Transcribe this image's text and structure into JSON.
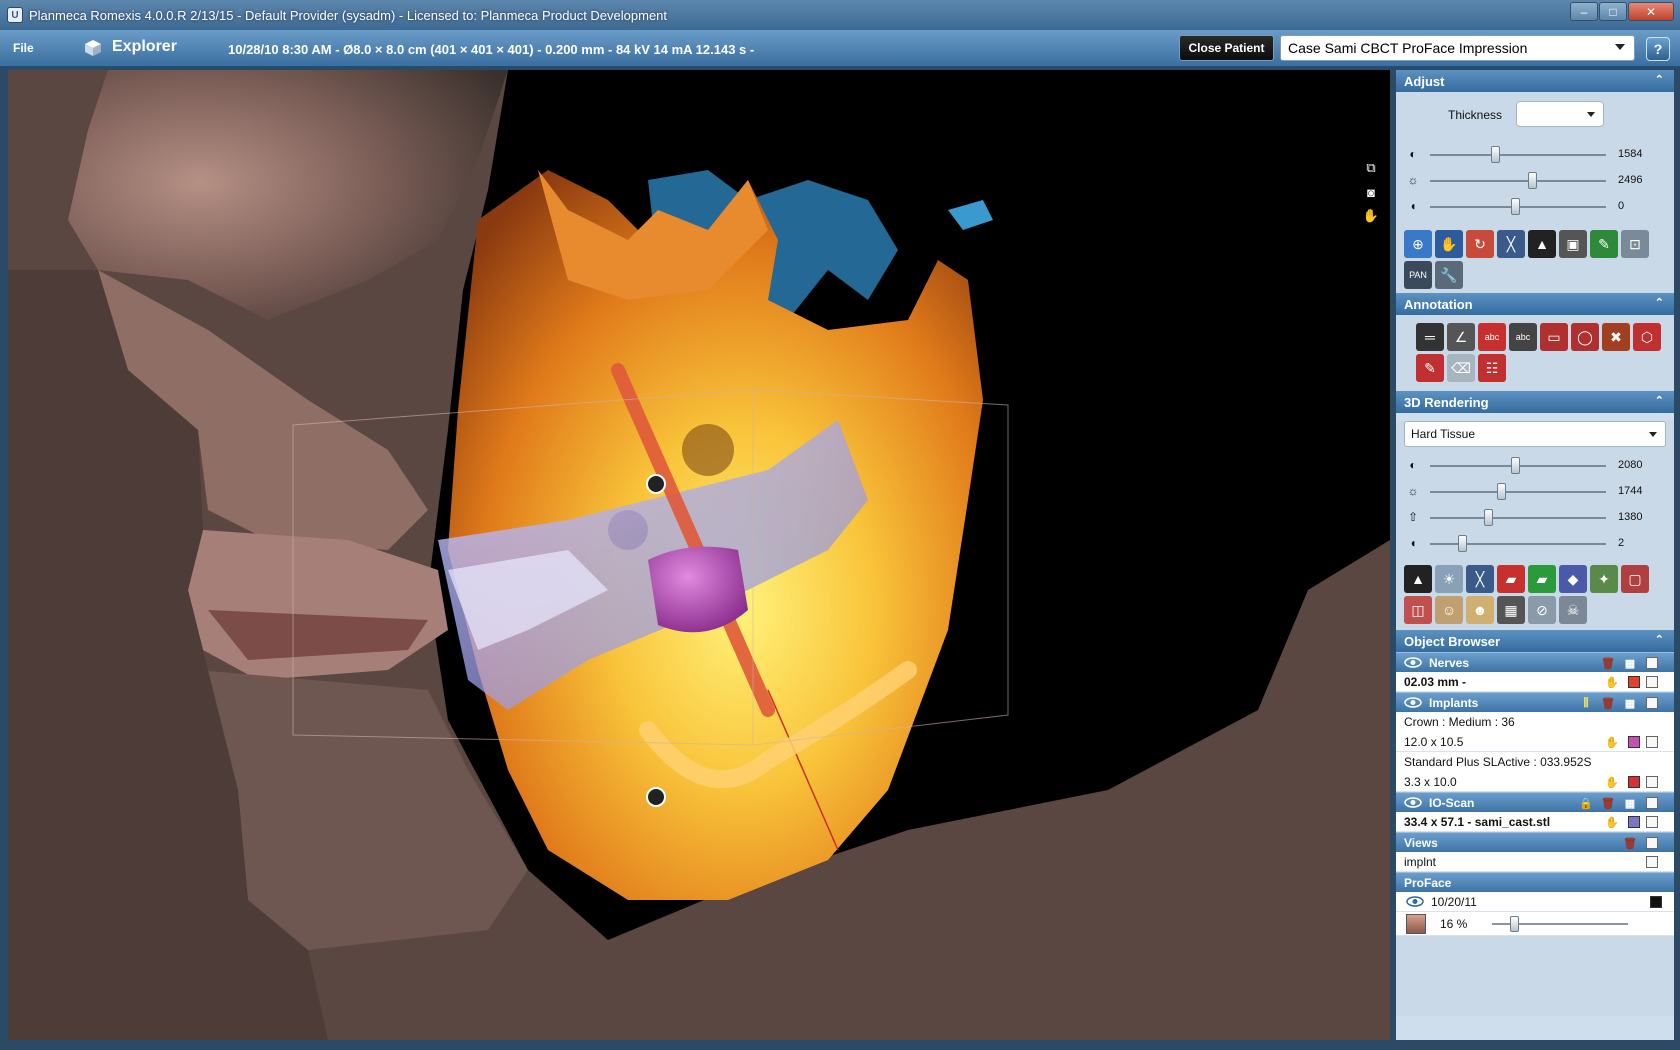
{
  "window": {
    "title": "Planmeca Romexis 4.0.0.R  2/13/15 - Default Provider (sysadm) - Licensed to: Planmeca Product Development",
    "minimize": "–",
    "maximize": "□",
    "close": "✕"
  },
  "header": {
    "file_menu": "File",
    "module": "Explorer",
    "scan_info": "10/28/10 8:30 AM - Ø8.0 × 8.0 cm (401 × 401 × 401) - 0.200 mm - 84 kV 14 mA 12.143 s -",
    "close_patient": "Close Patient",
    "case_select": "Case Sami  CBCT ProFace Impression",
    "help": "?"
  },
  "adjust": {
    "title": "Adjust",
    "thickness_label": "Thickness",
    "thickness_value": "",
    "sliders": [
      {
        "icon": "contrast-icon",
        "glyph": "◐",
        "value": "1584",
        "level": 0.38
      },
      {
        "icon": "brightness-icon",
        "glyph": "☼",
        "value": "2496",
        "level": 0.6
      },
      {
        "icon": "gamma-icon",
        "glyph": "◖",
        "value": "0",
        "level": 0.5
      }
    ]
  },
  "annotation": {
    "title": "Annotation"
  },
  "rendering": {
    "title": "3D Rendering",
    "preset": "Hard Tissue",
    "sliders": [
      {
        "icon": "contrast-icon",
        "glyph": "◐",
        "value": "2080",
        "level": 0.5
      },
      {
        "icon": "brightness-icon",
        "glyph": "☼",
        "value": "1744",
        "level": 0.42
      },
      {
        "icon": "opacity-icon",
        "glyph": "⇧",
        "value": "1380",
        "level": 0.34
      },
      {
        "icon": "gamma-icon",
        "glyph": "◖",
        "value": "2",
        "level": 0.19
      }
    ]
  },
  "object_browser": {
    "title": "Object Browser",
    "nerves": {
      "label": "Nerves",
      "item": "02.03 mm -"
    },
    "implants": {
      "label": "Implants",
      "crown_name": "Crown : Medium : 36",
      "crown_size": "12.0 x 10.5",
      "implant_name": "Standard Plus SLActive : 033.952S",
      "implant_size": "3.3 x 10.0"
    },
    "ioscan": {
      "label": "IO-Scan",
      "item": "33.4 x 57.1 - sami_cast.stl"
    },
    "views": {
      "label": "Views",
      "item": "implnt"
    },
    "proface": {
      "label": "ProFace",
      "date": "10/20/11",
      "opacity": "16 %",
      "opacity_level": 0.16
    }
  },
  "colors": {
    "nerve_swatch": "#e0432a",
    "crown_swatch": "#c84fb0",
    "implant_swatch": "#d83030",
    "ioscan_swatch": "#7c74c8",
    "proface_swatch": "#111111"
  }
}
